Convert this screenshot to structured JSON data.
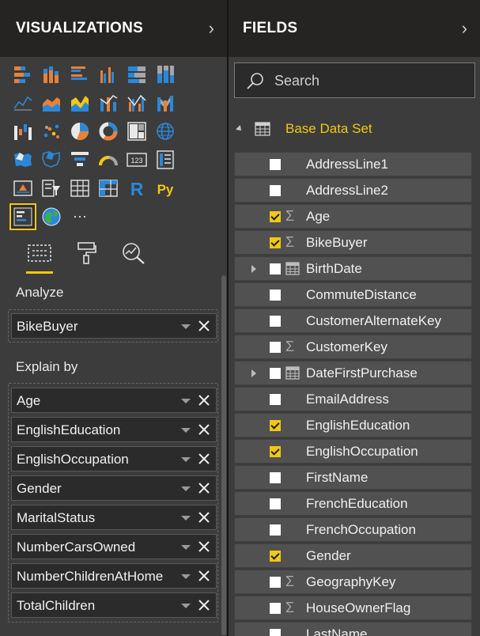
{
  "visualizations": {
    "title": "VISUALIZATIONS",
    "icons": [
      "stacked-bar-chart-icon",
      "stacked-column-chart-icon",
      "clustered-bar-chart-icon",
      "clustered-column-chart-icon",
      "100-percent-stacked-bar-chart-icon",
      "100-percent-stacked-column-chart-icon",
      "line-chart-icon",
      "area-chart-icon",
      "stacked-area-chart-icon",
      "line-and-stacked-column-chart-icon",
      "line-and-clustered-column-chart-icon",
      "ribbon-chart-icon",
      "waterfall-chart-icon",
      "scatter-chart-icon",
      "pie-chart-icon",
      "donut-chart-icon",
      "treemap-icon",
      "map-icon",
      "filled-map-icon",
      "shape-map-icon",
      "funnel-icon",
      "gauge-icon",
      "card-icon",
      "multi-row-card-icon",
      "kpi-icon",
      "slicer-icon",
      "table-icon",
      "matrix-icon",
      "r-visual-icon",
      "python-visual-icon",
      "key-influencers-icon",
      "arcgis-map-icon",
      "more-visuals-icon"
    ],
    "python_label": "Py",
    "r_label": "R",
    "card_label": "123",
    "more_label": "···",
    "tabs": [
      "fields-tab",
      "format-tab",
      "analytics-tab"
    ],
    "analyze_label": "Analyze",
    "analyze_field": "BikeBuyer",
    "explain_label": "Explain by",
    "explain_fields": [
      "Age",
      "EnglishEducation",
      "EnglishOccupation",
      "Gender",
      "MaritalStatus",
      "NumberCarsOwned",
      "NumberChildrenAtHome",
      "TotalChildren"
    ]
  },
  "fields": {
    "title": "FIELDS",
    "search_placeholder": "Search",
    "table_name": "Base Data Set",
    "rows": [
      {
        "name": "AddressLine1",
        "checked": false,
        "type": "",
        "expandable": false
      },
      {
        "name": "AddressLine2",
        "checked": false,
        "type": "",
        "expandable": false
      },
      {
        "name": "Age",
        "checked": true,
        "type": "sigma",
        "expandable": false
      },
      {
        "name": "BikeBuyer",
        "checked": true,
        "type": "sigma",
        "expandable": false
      },
      {
        "name": "BirthDate",
        "checked": false,
        "type": "calendar",
        "expandable": true
      },
      {
        "name": "CommuteDistance",
        "checked": false,
        "type": "",
        "expandable": false
      },
      {
        "name": "CustomerAlternateKey",
        "checked": false,
        "type": "",
        "expandable": false
      },
      {
        "name": "CustomerKey",
        "checked": false,
        "type": "sigma",
        "expandable": false
      },
      {
        "name": "DateFirstPurchase",
        "checked": false,
        "type": "calendar",
        "expandable": true
      },
      {
        "name": "EmailAddress",
        "checked": false,
        "type": "",
        "expandable": false
      },
      {
        "name": "EnglishEducation",
        "checked": true,
        "type": "",
        "expandable": false
      },
      {
        "name": "EnglishOccupation",
        "checked": true,
        "type": "",
        "expandable": false
      },
      {
        "name": "FirstName",
        "checked": false,
        "type": "",
        "expandable": false
      },
      {
        "name": "FrenchEducation",
        "checked": false,
        "type": "",
        "expandable": false
      },
      {
        "name": "FrenchOccupation",
        "checked": false,
        "type": "",
        "expandable": false
      },
      {
        "name": "Gender",
        "checked": true,
        "type": "",
        "expandable": false
      },
      {
        "name": "GeographyKey",
        "checked": false,
        "type": "sigma",
        "expandable": false
      },
      {
        "name": "HouseOwnerFlag",
        "checked": false,
        "type": "sigma",
        "expandable": false
      },
      {
        "name": "LastName",
        "checked": false,
        "type": "",
        "expandable": false
      }
    ]
  },
  "colors": {
    "accent": "#f2c811",
    "pane_dark": "#252423",
    "pane_mid": "#3c3c3c",
    "row_bg": "#515151"
  }
}
